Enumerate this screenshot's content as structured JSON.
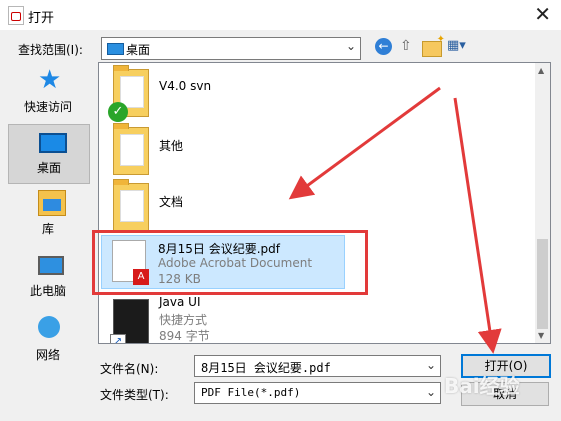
{
  "window": {
    "title": "打开"
  },
  "lookin": {
    "label": "查找范围(I):",
    "value": "桌面"
  },
  "places": [
    {
      "label": "快速访问",
      "icon": "star-icon"
    },
    {
      "label": "桌面",
      "icon": "desktop-icon"
    },
    {
      "label": "库",
      "icon": "library-icon"
    },
    {
      "label": "此电脑",
      "icon": "computer-icon"
    },
    {
      "label": "网络",
      "icon": "network-icon"
    }
  ],
  "files": [
    {
      "name": "V4.0 svn",
      "type": "folder-svn"
    },
    {
      "name": "其他",
      "type": "folder"
    },
    {
      "name": "文档",
      "type": "folder"
    },
    {
      "name": "8月15日 会议纪要.pdf",
      "kind": "Adobe Acrobat Document",
      "size": "128 KB",
      "type": "pdf",
      "selected": true
    },
    {
      "name": "Java UI",
      "kind": "快捷方式",
      "size": "894 字节",
      "type": "shortcut"
    }
  ],
  "filename": {
    "label": "文件名(N):",
    "value": "8月15日 会议纪要.pdf"
  },
  "filetype": {
    "label": "文件类型(T):",
    "value": "PDF File(*.pdf)"
  },
  "buttons": {
    "open": "打开(O)",
    "cancel": "取消"
  },
  "watermark": "Bai经验",
  "colors": {
    "selection": "#cce8ff",
    "annotation": "#e23a3a",
    "accent": "#0078d7"
  }
}
